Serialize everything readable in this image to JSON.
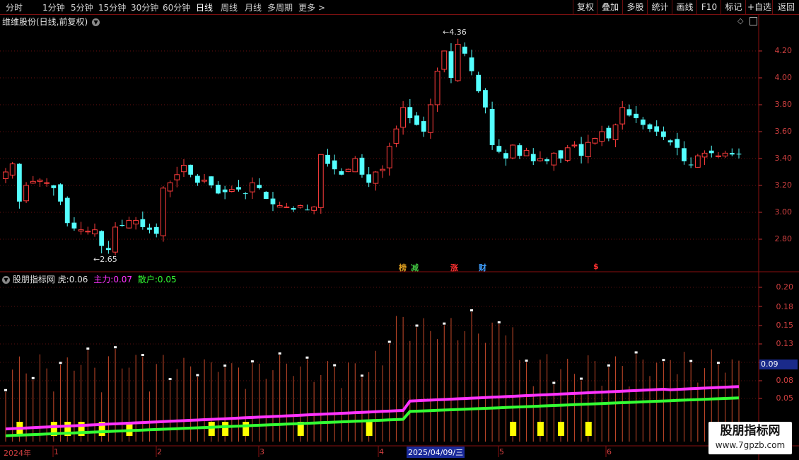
{
  "toolbar": {
    "periods": [
      "分时",
      "1分钟",
      "5分钟",
      "15分钟",
      "30分钟",
      "60分钟",
      "日线",
      "周线",
      "月线",
      "多周期",
      "更多"
    ],
    "active_period": "日线",
    "buttons": [
      "复权",
      "叠加",
      "多股",
      "统计",
      "画线",
      "F10",
      "标记",
      "+自选",
      "返回"
    ]
  },
  "main_panel": {
    "title": "维维股份(日线,前复权)",
    "y_ticks": [
      "4.20",
      "4.00",
      "3.80",
      "3.60",
      "3.40",
      "3.20",
      "3.00",
      "2.80"
    ],
    "high_label": "4.36",
    "low_label": "2.65",
    "signals": [
      {
        "text": "榜",
        "color": "#e0a020"
      },
      {
        "text": "减",
        "color": "#40c040"
      },
      {
        "text": "涨",
        "color": "#ff3030"
      },
      {
        "text": "财",
        "color": "#40a0ff"
      },
      {
        "text": "$",
        "color": "#ff3030"
      }
    ]
  },
  "indicator_panel": {
    "name": "股朋指标网",
    "tiger_label": "虎:",
    "tiger_value": "0.06",
    "main_label": "主力:",
    "main_value": "0.07",
    "retail_label": "散户:",
    "retail_value": "0.05",
    "y_ticks": [
      "0.20",
      "0.18",
      "0.15",
      "0.13",
      "0.09",
      "0.08",
      "0.05"
    ],
    "current_value": "0.09",
    "colors": {
      "main": "#ff33ff",
      "retail": "#33ff33",
      "bar": "#d24a2a",
      "marker": "#ffff00"
    }
  },
  "date_axis": {
    "labels": [
      "2024年",
      "1",
      "2",
      "3",
      "4",
      "5",
      "6"
    ],
    "cursor_date": "2025/04/09/三"
  },
  "watermark": {
    "line1": "股朋指标网",
    "line2": "www.7gpzb.com"
  },
  "chart_data": {
    "type": "candlestick",
    "price_range": [
      2.65,
      4.36
    ],
    "high": 4.36,
    "low": 2.65,
    "indicator_series": [
      {
        "name": "主力",
        "value": 0.07
      },
      {
        "name": "散户",
        "value": 0.05
      }
    ]
  }
}
